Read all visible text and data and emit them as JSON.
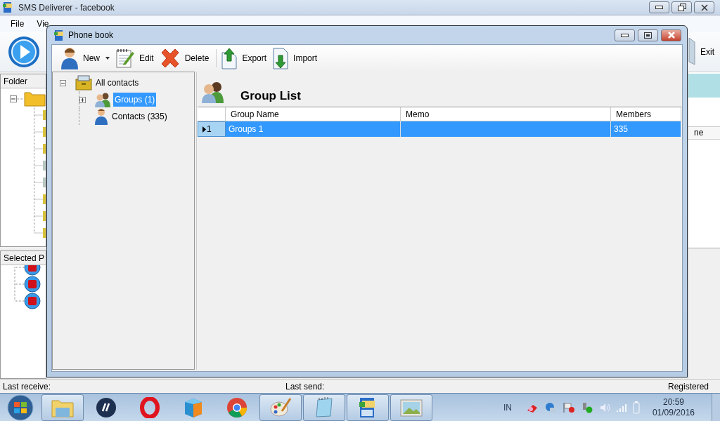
{
  "main_window": {
    "title": "SMS Deliverer - facebook",
    "menu": [
      "File",
      "Vie"
    ],
    "toolbar": {
      "exit": "Exit"
    },
    "folder_panel": {
      "header": "Folder"
    },
    "selected_panel": {
      "header": "Selected P"
    },
    "partial_header": "ne"
  },
  "dialog": {
    "title": "Phone book",
    "toolbar": [
      {
        "kind": "new",
        "label": "New",
        "dropdown": true
      },
      {
        "kind": "edit",
        "label": "Edit",
        "dropdown": false
      },
      {
        "kind": "delete",
        "label": "Delete",
        "dropdown": false
      },
      {
        "kind": "export",
        "label": "Export",
        "dropdown": false
      },
      {
        "kind": "import",
        "label": "Import",
        "dropdown": false
      }
    ],
    "tree": [
      {
        "label": "All contacts",
        "kind": "box",
        "expanded": true,
        "selected": false,
        "children": [
          {
            "label": "Groups (1)",
            "kind": "group",
            "expanded": false,
            "selected": true
          },
          {
            "label": "Contacts (335)",
            "kind": "person",
            "selected": false
          }
        ]
      }
    ],
    "heading": "Group List",
    "table": {
      "columns": [
        "Group Name",
        "Memo",
        "Members"
      ],
      "rows": [
        {
          "indicator": "1",
          "selected": true,
          "cells": [
            "Groups 1",
            "",
            "335"
          ]
        }
      ]
    }
  },
  "status_bar": {
    "left": "Last receive:",
    "middle": "Last send:",
    "right": "Registered"
  },
  "taskbar": {
    "items": [
      {
        "kind": "folder",
        "open": true
      },
      {
        "kind": "darkcircle",
        "open": false
      },
      {
        "kind": "redring",
        "open": false
      },
      {
        "kind": "cube",
        "open": false
      },
      {
        "kind": "chrome",
        "open": false
      },
      {
        "kind": "palette",
        "open": true
      },
      {
        "kind": "notepad",
        "open": true
      },
      {
        "kind": "phoneapp",
        "open": true
      },
      {
        "kind": "photo",
        "open": true
      }
    ],
    "language": "IN",
    "time": "20:59",
    "date": "01/09/2016"
  }
}
